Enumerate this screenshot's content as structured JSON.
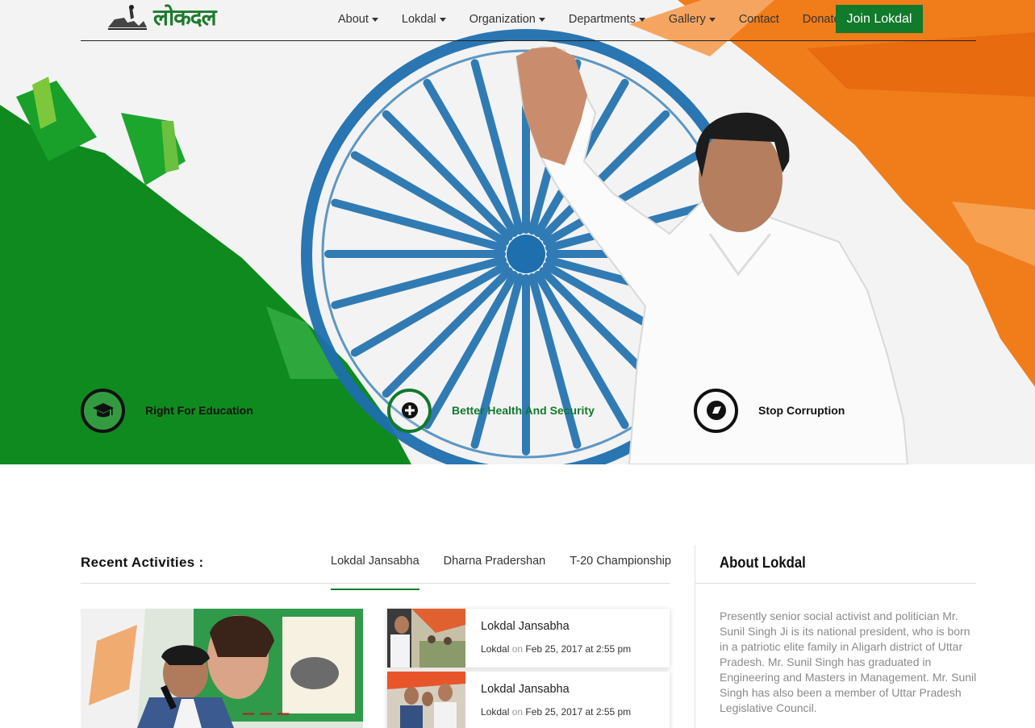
{
  "header": {
    "logo_text": "लोकदल",
    "nav": [
      {
        "label": "About",
        "dropdown": true
      },
      {
        "label": "Lokdal",
        "dropdown": true
      },
      {
        "label": "Organization",
        "dropdown": true
      },
      {
        "label": "Departments",
        "dropdown": true
      },
      {
        "label": "Gallery",
        "dropdown": true
      },
      {
        "label": "Contact",
        "dropdown": false
      },
      {
        "label": "Donate",
        "dropdown": false
      }
    ],
    "cta_label": "Join Lokdal"
  },
  "hero": {
    "features": [
      {
        "label": "Right For Education",
        "icon": "graduation-cap-icon"
      },
      {
        "label": "Better Health And Security",
        "icon": "plus-circle-icon"
      },
      {
        "label": "Stop Corruption",
        "icon": "compass-icon"
      }
    ]
  },
  "recent": {
    "title": "Recent Activities :",
    "tabs": [
      "Lokdal Jansabha",
      "Dharna Pradershan",
      "T-20 Championship"
    ],
    "active_tab": "Lokdal Jansabha",
    "items": [
      {
        "title": "Lokdal Jansabha",
        "author": "Lokdal",
        "on": "on",
        "date": "Feb 25, 2017 at 2:55 pm"
      },
      {
        "title": "Lokdal Jansabha",
        "author": "Lokdal",
        "on": "on",
        "date": "Feb 25, 2017 at 2:55 pm"
      }
    ]
  },
  "about": {
    "title": "About Lokdal",
    "text": "Presently senior social activist and politician Mr. Sunil Singh Ji is its national president, who is born in a patriotic elite family in Aligarh district of Uttar Pradesh. Mr. Sunil Singh has graduated in Engineering and Masters in Management. Mr. Sunil Singh has also been a member of Uttar Pradesh Legislative Council."
  },
  "colors": {
    "brand_green": "#117a2b",
    "saffron": "#f07d1a",
    "chakra_blue": "#1d6fae"
  }
}
